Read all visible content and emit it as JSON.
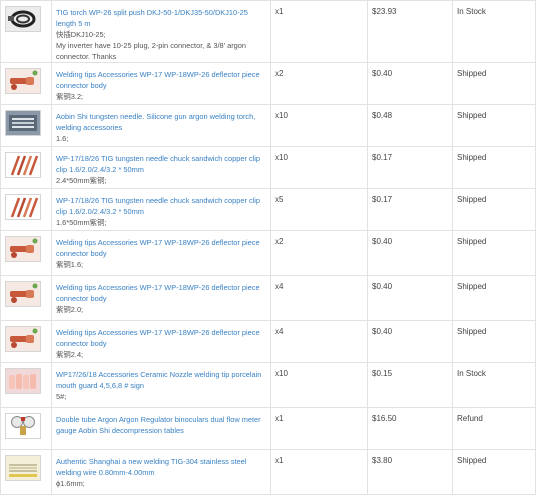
{
  "rows": [
    {
      "icon": "torch-cable-image",
      "title": "TIG torch WP-26 split push DKJ-50-1/DKJ35-50/DKJ10-25 length 5 m",
      "note": "快插DKJ10-25;\nMy inverter have 10-25 plug, 2-pin connector, & 3/8' argon connector. Thanks",
      "qty": "x1",
      "price": "$23.93",
      "status": "In Stock"
    },
    {
      "icon": "deflector-piece-image",
      "title": "Welding tips Accessories WP-17 WP-18WP-26 deflector piece connector body",
      "note": "紫铜3.2;",
      "qty": "x2",
      "price": "$0.40",
      "status": "Shipped"
    },
    {
      "icon": "tungsten-needle-image",
      "title": "Aobin Shi tungsten needle. Silicone gun argon welding torch, welding accessories",
      "note": "1.6;",
      "qty": "x10",
      "price": "$0.48",
      "status": "Shipped"
    },
    {
      "icon": "collet-clip-image",
      "title": "WP-17/18/26 TIG tungsten needle chuck sandwich copper clip clip 1.6/2.0/2.4/3.2 * 50mm",
      "note": "2.4*50mm紫铜;",
      "qty": "x10",
      "price": "$0.17",
      "status": "Shipped"
    },
    {
      "icon": "collet-clip-image",
      "title": "WP-17/18/26 TIG tungsten needle chuck sandwich copper clip clip 1.6/2.0/2.4/3.2 * 50mm",
      "note": "1.6*50mm紫铜;",
      "qty": "x5",
      "price": "$0.17",
      "status": "Shipped"
    },
    {
      "icon": "deflector-piece-image",
      "title": "Welding tips Accessories WP-17 WP-18WP-26 deflector piece connector body",
      "note": "紫铜1.6;",
      "qty": "x2",
      "price": "$0.40",
      "status": "Shipped"
    },
    {
      "icon": "deflector-piece-image",
      "title": "Welding tips Accessories WP-17 WP-18WP-26 deflector piece connector body",
      "note": "紫铜2.0;",
      "qty": "x4",
      "price": "$0.40",
      "status": "Shipped"
    },
    {
      "icon": "deflector-piece-image",
      "title": "Welding tips Accessories WP-17 WP-18WP-26 deflector piece connector body",
      "note": "紫铜2.4;",
      "qty": "x4",
      "price": "$0.40",
      "status": "Shipped"
    },
    {
      "icon": "ceramic-nozzle-image",
      "title": "WP17/26/18 Accessories Ceramic Nozzle welding tip porcelain mouth guard 4,5,6,8 # sign",
      "note": "5#;",
      "qty": "x10",
      "price": "$0.15",
      "status": "In Stock"
    },
    {
      "icon": "flow-meter-image",
      "title": "Double tube Argon Argon Regulator binoculars dual flow meter gauge Aobin Shi decompression tables",
      "note": "",
      "qty": "x1",
      "price": "$16.50",
      "status": "Refund"
    },
    {
      "icon": "welding-wire-image",
      "title": "Authentic Shanghai a new welding TIG-304 stainless steel welding wire 0.80mm-4.00mm",
      "note": "ϕ1.6mm;",
      "qty": "x1",
      "price": "$3.80",
      "status": "Shipped"
    }
  ]
}
